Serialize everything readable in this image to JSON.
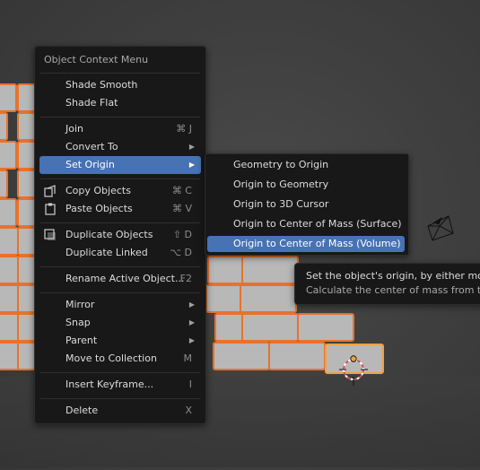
{
  "menu": {
    "title": "Object Context Menu",
    "items": [
      {
        "label": "Shade Smooth",
        "shortcut": ""
      },
      {
        "label": "Shade Flat",
        "shortcut": ""
      },
      {
        "label": "Join",
        "shortcut": "⌘ J"
      },
      {
        "label": "Convert To",
        "shortcut": ""
      },
      {
        "label": "Set Origin",
        "shortcut": ""
      },
      {
        "label": "Copy Objects",
        "shortcut": "⌘ C",
        "icon": "copy-icon"
      },
      {
        "label": "Paste Objects",
        "shortcut": "⌘ V",
        "icon": "paste-icon"
      },
      {
        "label": "Duplicate Objects",
        "shortcut": "⇧ D",
        "icon": "duplicate-icon"
      },
      {
        "label": "Duplicate Linked",
        "shortcut": "⌥ D"
      },
      {
        "label": "Rename Active Object...",
        "shortcut": "F2"
      },
      {
        "label": "Mirror",
        "shortcut": ""
      },
      {
        "label": "Snap",
        "shortcut": ""
      },
      {
        "label": "Parent",
        "shortcut": ""
      },
      {
        "label": "Move to Collection",
        "shortcut": "M"
      },
      {
        "label": "Insert Keyframe...",
        "shortcut": "I"
      },
      {
        "label": "Delete",
        "shortcut": "X"
      }
    ]
  },
  "submenu": {
    "items": [
      {
        "label": "Geometry to Origin"
      },
      {
        "label": "Origin to Geometry"
      },
      {
        "label": "Origin to 3D Cursor"
      },
      {
        "label": "Origin to Center of Mass (Surface)"
      },
      {
        "label": "Origin to Center of Mass (Volume)"
      }
    ],
    "active_index": 4
  },
  "tooltip": {
    "line1": "Set the object's origin, by either moving",
    "line2": "Calculate the center of mass from the v"
  },
  "colors": {
    "highlight": "#4772b3",
    "selection_outline": "#e8722c",
    "brick_fill": "#b8b8b8",
    "active_outline": "#f0a040"
  }
}
